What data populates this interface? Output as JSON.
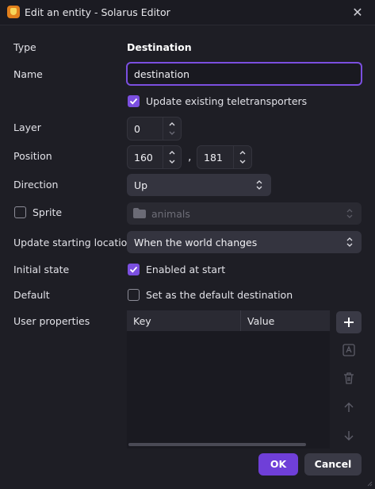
{
  "window": {
    "title": "Edit an entity - Solarus Editor",
    "close_glyph": "✕",
    "icon": "solarus-app-icon"
  },
  "form": {
    "type_label": "Type",
    "type_value": "Destination",
    "name_label": "Name",
    "name_value": "destination",
    "update_teletransporters": {
      "label": "Update existing teletransporters",
      "checked": true
    },
    "layer_label": "Layer",
    "layer_value": "0",
    "position_label": "Position",
    "position_x": "160",
    "position_separator": ",",
    "position_y": "181",
    "direction_label": "Direction",
    "direction_value": "Up",
    "sprite_label": "Sprite",
    "sprite_checked": false,
    "sprite_value": "animals",
    "sprite_icon": "folder-icon",
    "update_start_label": "Update starting location",
    "update_start_value": "When the world changes",
    "initial_state_label": "Initial state",
    "initial_state": {
      "label": "Enabled at start",
      "checked": true
    },
    "default_label": "Default",
    "default_checkbox": {
      "label": "Set as the default destination",
      "checked": false
    },
    "user_properties_label": "User properties",
    "table_columns": [
      "Key",
      "Value"
    ],
    "table_rows": []
  },
  "side_buttons": [
    "add-icon",
    "rename-icon",
    "trash-icon",
    "arrow-up-icon",
    "arrow-down-icon"
  ],
  "buttons": {
    "ok": "OK",
    "cancel": "Cancel"
  },
  "colors": {
    "accent": "#7b4fe0",
    "ok_button": "#6f3fd8",
    "background": "#1e1e25"
  }
}
